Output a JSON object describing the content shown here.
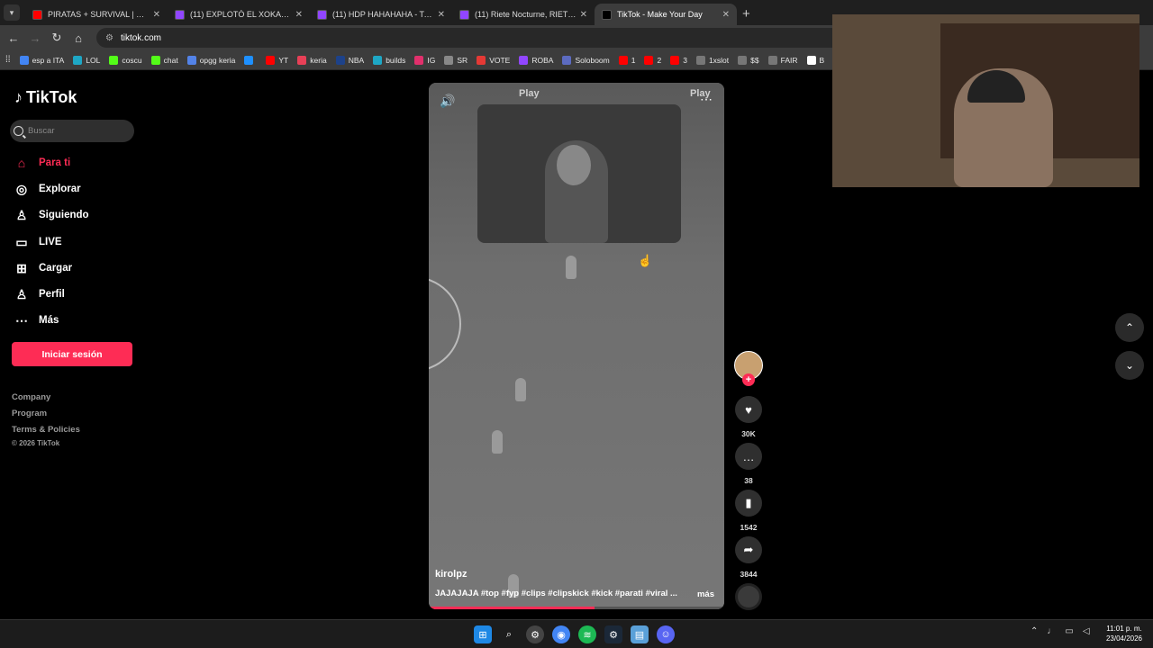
{
  "browser": {
    "tabs": [
      {
        "title": "PIRATAS + SURVIVAL | WindRo...",
        "color": "#ff0000",
        "active": false
      },
      {
        "title": "(11) EXPLOTÓ EL XOKAS - Twitc",
        "color": "#9146ff",
        "active": false
      },
      {
        "title": "(11) HDP HAHAHAHA - Twitch",
        "color": "#9146ff",
        "active": false
      },
      {
        "title": "(11) Riete Nocturne, RIETE ! xdd",
        "color": "#9146ff",
        "active": false
      },
      {
        "title": "TikTok - Make Your Day",
        "color": "#000000",
        "active": true
      }
    ],
    "url": "tiktok.com",
    "bookmarks": [
      {
        "label": "esp a ITA",
        "color": "#4285f4"
      },
      {
        "label": "LOL",
        "color": "#1ea7c5"
      },
      {
        "label": "coscu",
        "color": "#53fc18"
      },
      {
        "label": "chat",
        "color": "#53fc18"
      },
      {
        "label": "opgg keria",
        "color": "#5383e8"
      },
      {
        "label": "",
        "color": "#1e90ff"
      },
      {
        "label": "YT",
        "color": "#ff0000"
      },
      {
        "label": "keria",
        "color": "#e84057"
      },
      {
        "label": "NBA",
        "color": "#1d428a"
      },
      {
        "label": "builds",
        "color": "#1ea7c5"
      },
      {
        "label": "IG",
        "color": "#e1306c"
      },
      {
        "label": "SR",
        "color": "#888888"
      },
      {
        "label": "VOTE",
        "color": "#e53935"
      },
      {
        "label": "ROBA",
        "color": "#9146ff"
      },
      {
        "label": "Soloboom",
        "color": "#5c6bc0"
      },
      {
        "label": "1",
        "color": "#ff0000"
      },
      {
        "label": "2",
        "color": "#ff0000"
      },
      {
        "label": "3",
        "color": "#ff0000"
      },
      {
        "label": "1xslot",
        "color": "#777777"
      },
      {
        "label": "$$",
        "color": "#777777"
      },
      {
        "label": "FAIR",
        "color": "#777777"
      },
      {
        "label": "B",
        "color": "#ffffff"
      }
    ]
  },
  "sidebar": {
    "logo": "TikTok",
    "search_placeholder": "Buscar",
    "items": [
      {
        "label": "Para ti",
        "icon": "home-icon",
        "glyph": "⌂"
      },
      {
        "label": "Explorar",
        "icon": "compass-icon",
        "glyph": "◎"
      },
      {
        "label": "Siguiendo",
        "icon": "following-icon",
        "glyph": "♙"
      },
      {
        "label": "LIVE",
        "icon": "live-icon",
        "glyph": "▭"
      },
      {
        "label": "Cargar",
        "icon": "upload-icon",
        "glyph": "⊞"
      },
      {
        "label": "Perfil",
        "icon": "profile-icon",
        "glyph": "♙"
      },
      {
        "label": "Más",
        "icon": "more-icon",
        "glyph": "⋯"
      }
    ],
    "login_label": "Iniciar sesión",
    "footer": {
      "company": "Company",
      "program": "Program",
      "terms": "Terms & Policies",
      "copyright": "© 2026 TikTok"
    }
  },
  "video": {
    "watermark": "Play",
    "author": "kirolpz",
    "caption": "JAJAJAJA #top #fyp #clips #clipskick #kick #parati #viral ...",
    "more_label": "más",
    "progress": 0.56
  },
  "actions": {
    "likes": "30K",
    "comments": "38",
    "saves": "1542",
    "shares": "3844"
  },
  "taskbar": {
    "time": "11:01 p. m.",
    "date": "23/04/2026"
  },
  "colors": {
    "accent": "#fe2c55"
  }
}
